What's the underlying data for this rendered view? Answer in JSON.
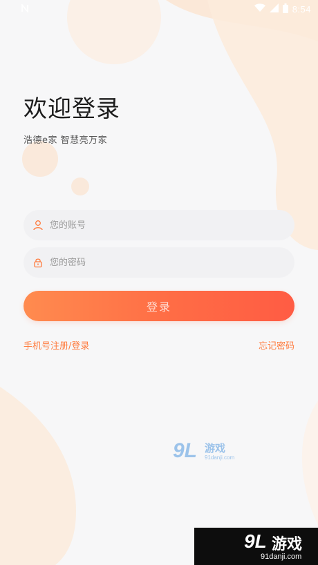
{
  "status_bar": {
    "time": "8:54",
    "left_icon": "notification-n-icon",
    "wifi_icon": "wifi-icon",
    "signal_icon": "signal-icon",
    "battery_icon": "battery-icon"
  },
  "login": {
    "title": "欢迎登录",
    "subtitle": "浩德e家  智慧亮万家",
    "account_placeholder": "您的账号",
    "account_icon": "user-icon",
    "password_placeholder": "您的密码",
    "password_icon": "lock-icon",
    "login_button": "登录",
    "register_link": "手机号注册/登录",
    "forgot_link": "忘记密码"
  },
  "watermarks": {
    "center": {
      "logo": "9L",
      "name": "游戏",
      "domain": "91danji.com"
    },
    "corner": {
      "logo": "9L",
      "name": "游戏",
      "domain": "91danji.com"
    }
  },
  "colors": {
    "accent": "#ff7a3c",
    "button_start": "#ff8b4f",
    "button_end": "#ff5c44",
    "field_bg": "#f1f1f3",
    "blob": "#fcebdc"
  }
}
